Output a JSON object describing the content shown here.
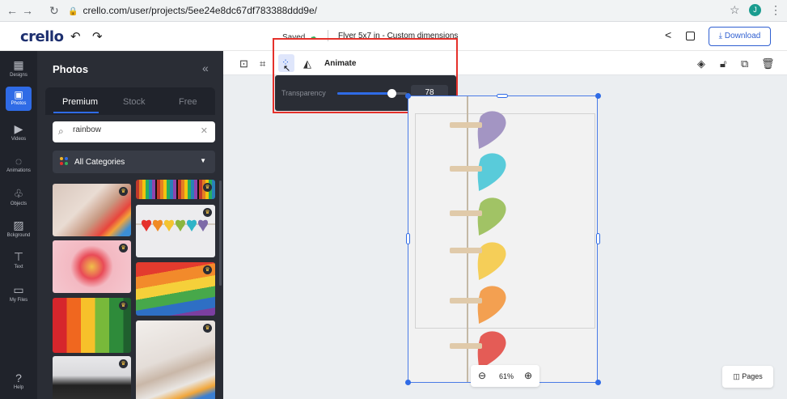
{
  "browser": {
    "url": "crello.com/user/projects/5ee24e8dc67df783388ddd9e/",
    "profile_initial": "J"
  },
  "header": {
    "logo": "crello",
    "saved_label": "Saved",
    "doc_title": "Flyer 5x7 in - Custom dimensions",
    "download_label": "Download"
  },
  "rail": {
    "items": [
      {
        "label": "Designs"
      },
      {
        "label": "Photos"
      },
      {
        "label": "Videos"
      },
      {
        "label": "Animations"
      },
      {
        "label": "Objects"
      },
      {
        "label": "Bckground"
      },
      {
        "label": "Text"
      },
      {
        "label": "My Files"
      },
      {
        "label": "Help"
      }
    ]
  },
  "panel": {
    "title": "Photos",
    "tabs": [
      {
        "label": "Premium"
      },
      {
        "label": "Stock"
      },
      {
        "label": "Free"
      }
    ],
    "search_value": "rainbow",
    "category": "All Categories"
  },
  "toolbar": {
    "animate_label": "Animate"
  },
  "transparency": {
    "label": "Transparency",
    "value": "78",
    "level": 0.78
  },
  "canvas": {
    "zoom_value": "61%",
    "pages_label": "Pages"
  },
  "colors": {
    "accent": "#2f6be6",
    "highlight_box": "#e5312b",
    "panel_bg": "#2a2d35",
    "rail_bg": "#20232b"
  }
}
